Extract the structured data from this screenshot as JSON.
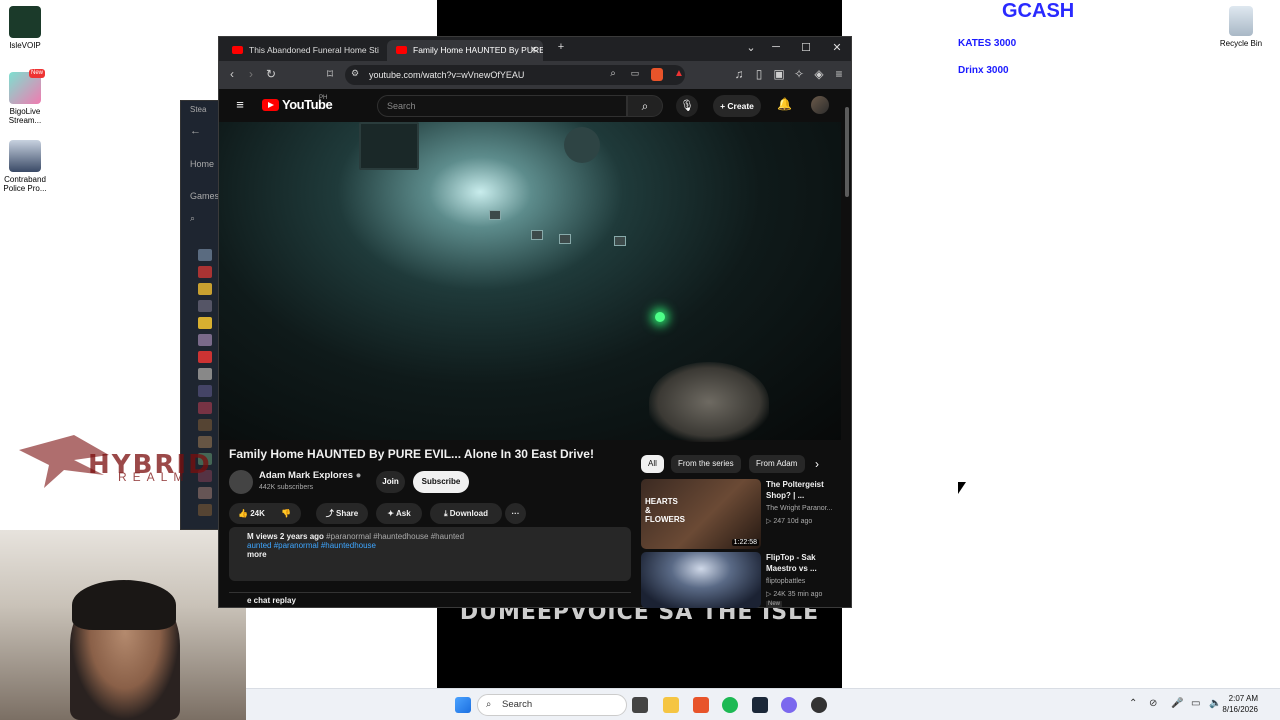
{
  "desktop": {
    "icons": [
      {
        "label": "IsleVOIP"
      },
      {
        "label": "BigoLive Stream..."
      },
      {
        "label": "Contraband Police Pro..."
      },
      {
        "label": "Recycle Bin"
      }
    ],
    "overlay": {
      "gcash": "GCASH",
      "kates": "KATES 3000",
      "drinx": "Drinx 3000"
    },
    "stream_caption": "DUMEEPVOICE SA THE ISLE",
    "hybrid_brand": "HYBRID",
    "hybrid_sub": "REALM",
    "new_badge": "New"
  },
  "steam": {
    "title": "Stea",
    "home": "Home",
    "games": "Games"
  },
  "browser": {
    "tabs": [
      {
        "label": "This Abandoned Funeral Home Still H"
      },
      {
        "label": "Family Home HAUNTED By PURE"
      }
    ],
    "url": "youtube.com/watch?v=wVnewOfYEAU",
    "close_tab": "✕",
    "new_tab": "+",
    "min": "─",
    "max": "☐",
    "close": "✕"
  },
  "youtube": {
    "logo": "YouTube",
    "logo_country": "PH",
    "search_placeholder": "Search",
    "create": "+ Create",
    "video_title": "Family Home HAUNTED By PURE EVIL... Alone In 30 East Drive!",
    "channel_name": "Adam Mark Explores",
    "channel_subs": "442K subscribers",
    "join": "Join",
    "subscribe": "Subscribe",
    "likes": "24K",
    "share": "Share",
    "ask": "Ask",
    "download": "Download",
    "more": "···",
    "desc_line1_a": "M views  2 years ago",
    "desc_line1_b": "#paranormal #hauntedhouse #haunted",
    "desc_line2": "aunted  #paranormal #hauntedhouse",
    "desc_more": "more",
    "chat_replay": "e chat replay",
    "chips": [
      "All",
      "From the series",
      "From Adam"
    ],
    "recs": [
      {
        "title": "The Poltergeist Shop? | ...",
        "channel": "The Wright Paranor...",
        "meta": "▷ 247  10d ago",
        "duration": "1:22:58",
        "thumb_text": "HEARTS & FLOWERS"
      },
      {
        "title": "FlipTop - Sak Maestro vs ...",
        "channel": "fliptopbattles",
        "meta": "▷ 24K  35 min ago",
        "duration": "",
        "thumb_text": "",
        "badge": "New"
      }
    ]
  },
  "taskbar": {
    "search": "Search",
    "time": "2:07 AM",
    "date": "8/16/2026"
  }
}
